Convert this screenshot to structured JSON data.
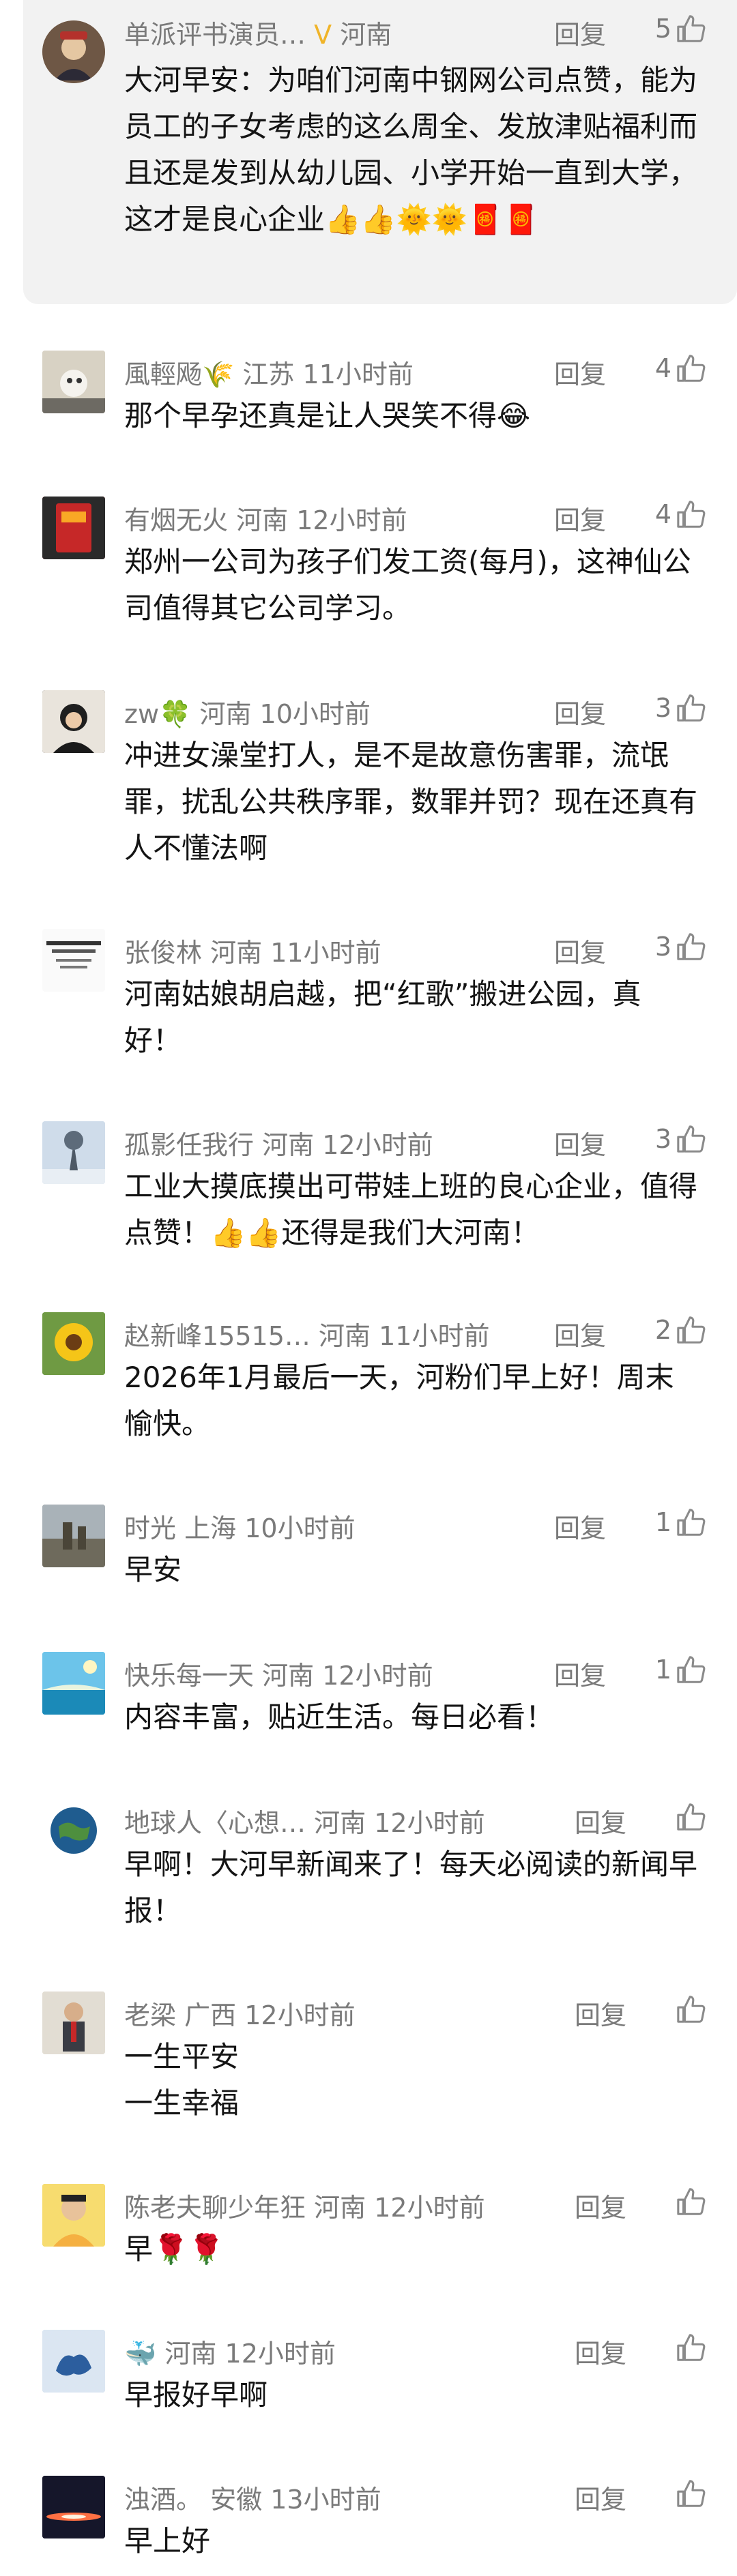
{
  "comments": [
    {
      "name": "单派评书演员…",
      "badge": "Ⅴ",
      "location": "河南",
      "time": "",
      "reply": "回复",
      "likes": "5",
      "text": "大河早安：为咱们河南中钢网公司点赞，能为员工的子女考虑的这么周全、发放津贴福利而且还是发到从幼儿园、小学开始一直到大学，这才是良心企业👍👍🌞🌞🧧🧧"
    },
    {
      "name": "風輕飏🌾",
      "location": "江苏",
      "time": "11小时前",
      "reply": "回复",
      "likes": "4",
      "text": "那个早孕还真是让人哭笑不得😂"
    },
    {
      "name": "有烟无火",
      "location": "河南",
      "time": "12小时前",
      "reply": "回复",
      "likes": "4",
      "text": "郑州一公司为孩子们发工资(每月)，这神仙公司值得其它公司学习。"
    },
    {
      "name": "zw🍀",
      "location": "河南",
      "time": "10小时前",
      "reply": "回复",
      "likes": "3",
      "text": "冲进女澡堂打人，是不是故意伤害罪，流氓罪，扰乱公共秩序罪，数罪并罚？现在还真有人不懂法啊"
    },
    {
      "name": "张俊林",
      "location": "河南",
      "time": "11小时前",
      "reply": "回复",
      "likes": "3",
      "text": "河南姑娘胡启越，把“红歌”搬进公园，真好！"
    },
    {
      "name": "孤影任我行",
      "location": "河南",
      "time": "12小时前",
      "reply": "回复",
      "likes": "3",
      "text": "工业大摸底摸出可带娃上班的良心企业，值得点赞！👍👍还得是我们大河南！"
    },
    {
      "name": "赵新峰15515…",
      "location": "河南",
      "time": "11小时前",
      "reply": "回复",
      "likes": "2",
      "text": "2026年1月最后一天，河粉们早上好！周末愉快。"
    },
    {
      "name": "时光",
      "location": "上海",
      "time": "10小时前",
      "reply": "回复",
      "likes": "1",
      "text": "早安"
    },
    {
      "name": "快乐每一天",
      "location": "河南",
      "time": "12小时前",
      "reply": "回复",
      "likes": "1",
      "text": "内容丰富，贴近生活。每日必看！"
    },
    {
      "name": "地球人〈心想…",
      "location": "河南",
      "time": "12小时前",
      "reply": "回复",
      "likes": "",
      "text": "早啊！大河早新闻来了！每天必阅读的新闻早报！"
    },
    {
      "name": "老梁",
      "location": "广西",
      "time": "12小时前",
      "reply": "回复",
      "likes": "",
      "text": "一生平安\n一生幸福"
    },
    {
      "name": "陈老夫聊少年狂",
      "location": "河南",
      "time": "12小时前",
      "reply": "回复",
      "likes": "",
      "text": "早🌹🌹"
    },
    {
      "name": "🐳",
      "location": "河南",
      "time": "12小时前",
      "reply": "回复",
      "likes": "",
      "text": "早报好早啊"
    },
    {
      "name": "浊酒。",
      "location": "安徽",
      "time": "13小时前",
      "reply": "回复",
      "likes": "",
      "text": "早上好"
    }
  ],
  "colors": {
    "meta": "#7a7a7a",
    "text": "#141414",
    "first_bg": "#f2f2f2",
    "badge": "#f0b429"
  }
}
